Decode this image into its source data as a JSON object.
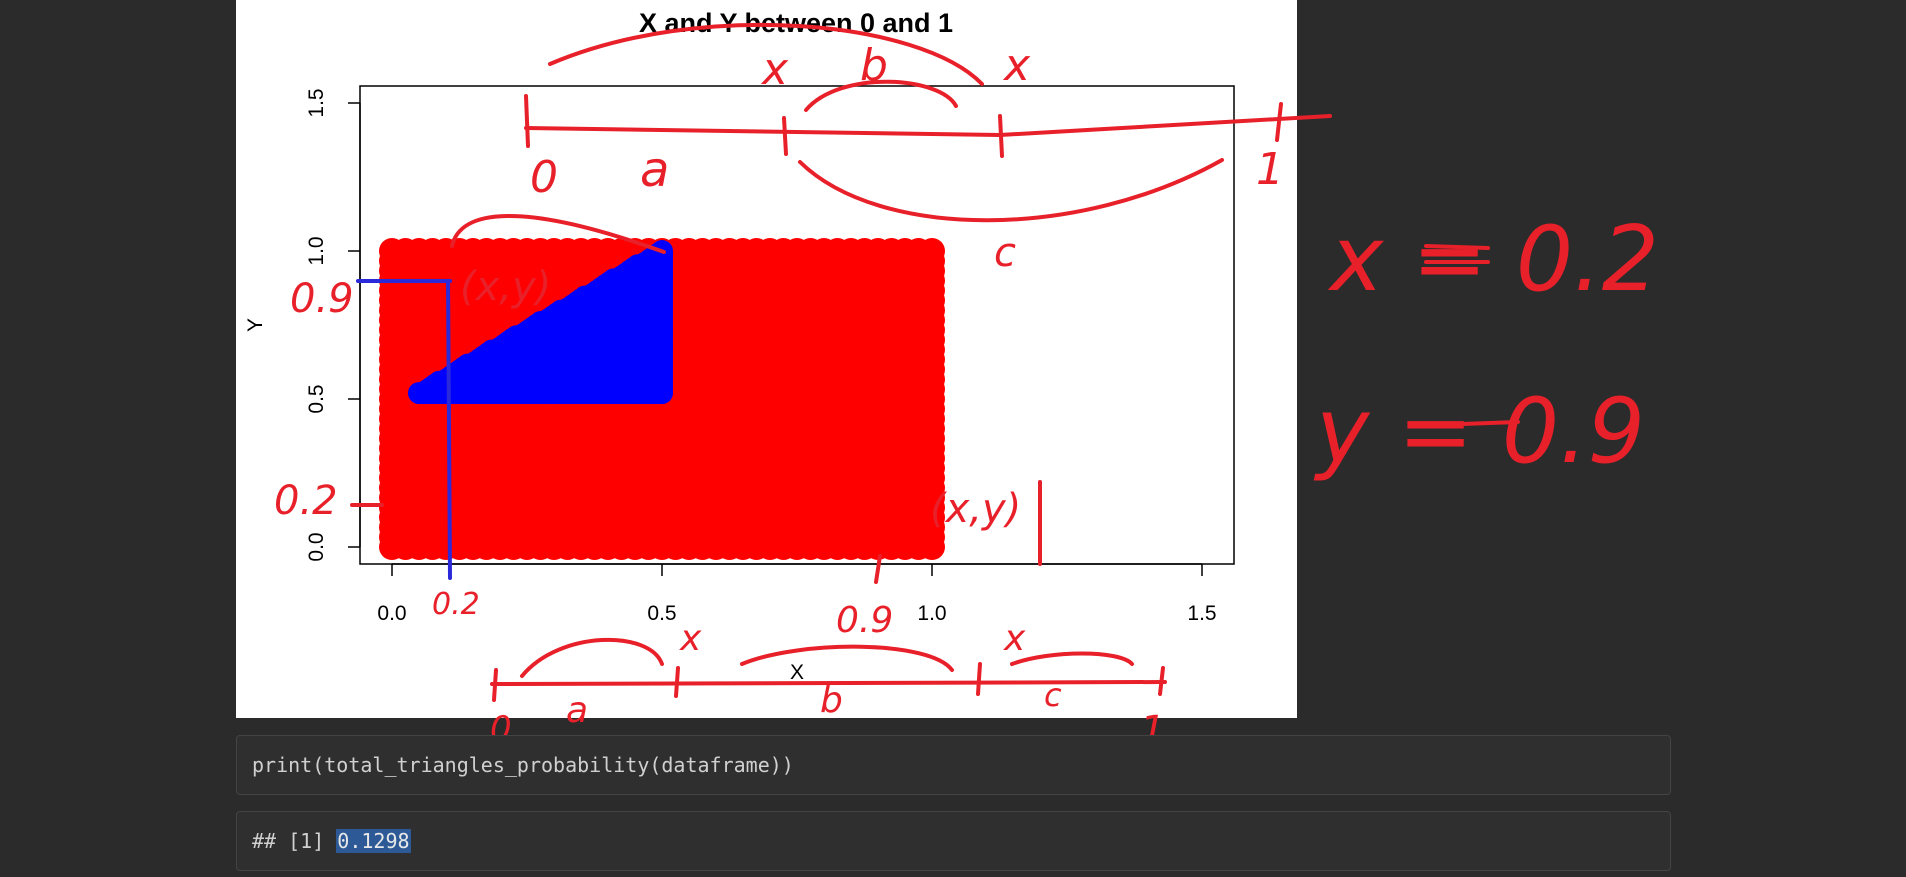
{
  "plot": {
    "title": "X and Y between 0 and 1",
    "xlabel": "X",
    "ylabel": "Y"
  },
  "chart_data": {
    "type": "scatter",
    "title": "X and Y between 0 and 1",
    "xlabel": "X",
    "ylabel": "Y",
    "xlim": [
      -0.06,
      1.56
    ],
    "ylim": [
      -0.06,
      1.56
    ],
    "x_ticks": [
      "0.0",
      "0.5",
      "1.0",
      "1.5"
    ],
    "y_ticks": [
      "0.0",
      "0.5",
      "1.0",
      "1.5"
    ],
    "grid": false,
    "series": [
      {
        "color": "#ff0000",
        "region_x": [
          0,
          1
        ],
        "region_y": [
          0,
          1
        ]
      },
      {
        "color": "#0000ff",
        "region_polygon": [
          [
            0.05,
            0.52
          ],
          [
            0.5,
            1.0
          ],
          [
            0.5,
            0.52
          ]
        ]
      }
    ]
  },
  "annotations": {
    "top_line_labels": [
      "x",
      "b",
      "x",
      "0",
      "a",
      "1",
      "c"
    ],
    "bottom_line_labels": [
      "x",
      "0.9",
      "x",
      "0",
      "a",
      "b",
      "c",
      "1"
    ],
    "left_labels": [
      "0.9",
      "0.2",
      "0.2",
      "(x,y)",
      "(x,y)"
    ],
    "right_equations": [
      "x = 0.2",
      "y = 0.9"
    ]
  },
  "cells": {
    "code": "print(total_triangles_probability(dataframe))",
    "output_prefix": "## [1] ",
    "output_value": "0.1298"
  },
  "colors": {
    "background": "#2b2b2b",
    "red": "#ff0000",
    "blue": "#0000ff",
    "ink": "#e8202a",
    "selection": "#2d5a96"
  }
}
